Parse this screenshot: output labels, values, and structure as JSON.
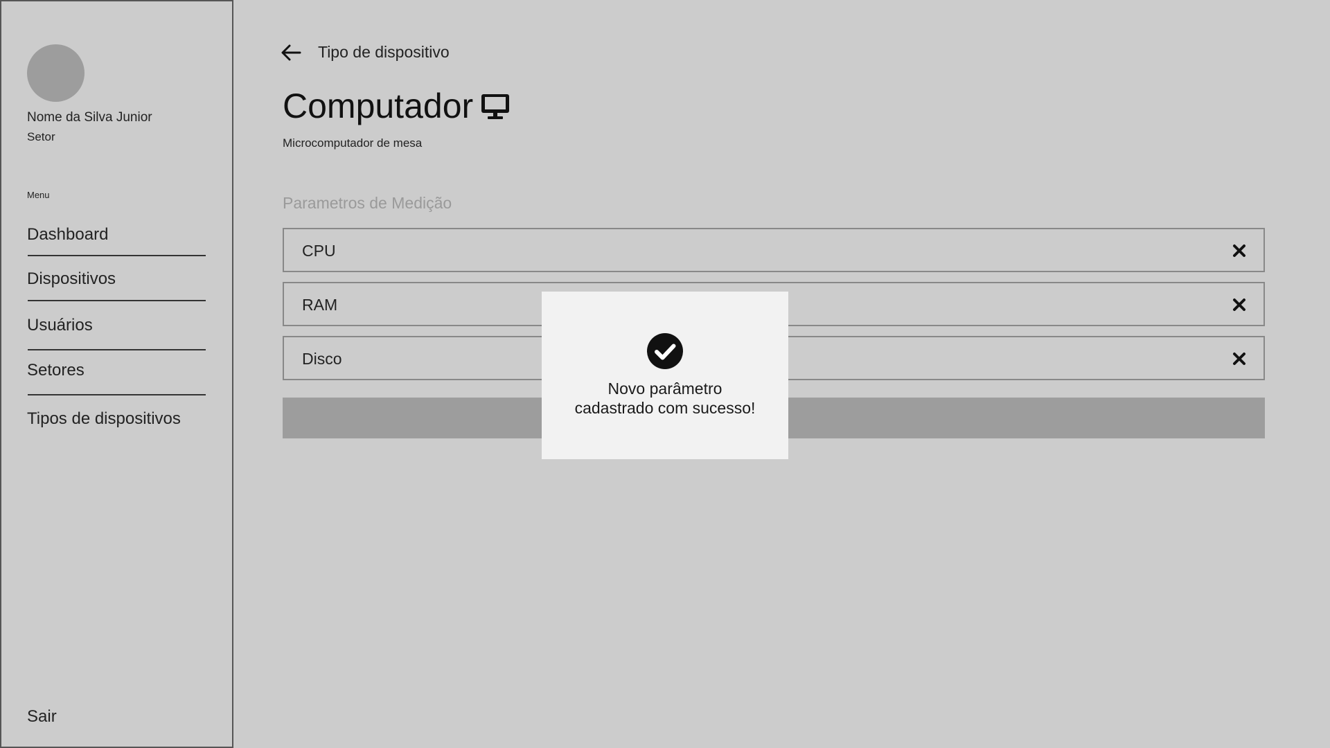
{
  "sidebar": {
    "user_name": "Nome da Silva Junior",
    "user_sector": "Setor",
    "menu_heading": "Menu",
    "items": [
      {
        "label": "Dashboard"
      },
      {
        "label": "Dispositivos"
      },
      {
        "label": "Usuários"
      },
      {
        "label": "Setores"
      },
      {
        "label": "Tipos de dispositivos"
      }
    ],
    "logout_label": "Sair"
  },
  "header": {
    "breadcrumb": "Tipo de dispositivo",
    "title": "Computador",
    "title_icon": "monitor-icon",
    "subtitle": "Microcomputador de mesa"
  },
  "parameters": {
    "section_title": "Parametros de Medição",
    "items": [
      {
        "label": "CPU"
      },
      {
        "label": "RAM"
      },
      {
        "label": "Disco"
      }
    ]
  },
  "modal": {
    "icon": "check-circle-icon",
    "line1": "Novo parâmetro",
    "line2": "cadastrado com sucesso!"
  },
  "colors": {
    "background": "#cccccc",
    "avatar": "#9d9d9d",
    "add_bar": "#9d9d9d",
    "modal_bg": "#f2f2f2",
    "section_title": "#9a9a9a"
  }
}
